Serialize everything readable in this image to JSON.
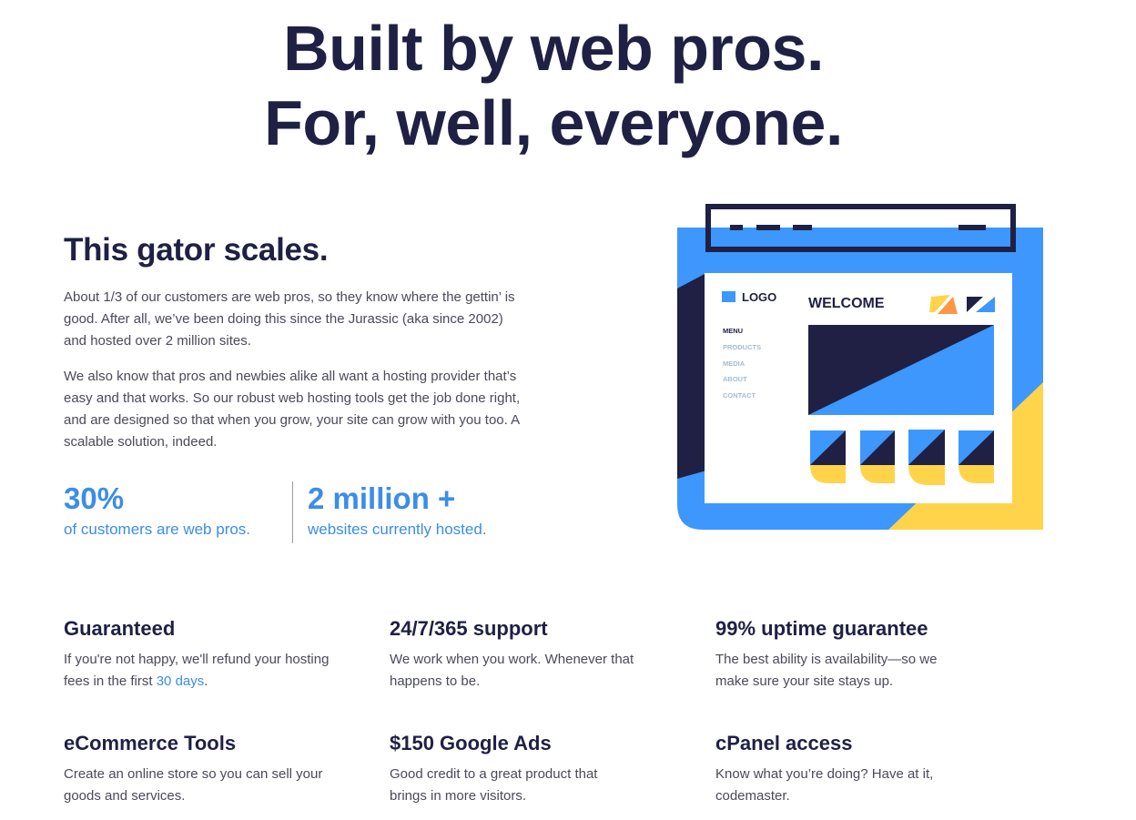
{
  "hero": {
    "line1": "Built by web pros.",
    "line2": "For, well, everyone."
  },
  "about": {
    "heading": "This gator scales.",
    "paragraphs": [
      "About 1/3 of our customers are web pros, so they know where the gettin’ is good. After all, we’ve been doing this since the Jurassic (aka since 2002) and hosted over 2 million sites.",
      "We also know that pros and newbies alike all want a hosting provider that’s easy and that works. So our robust web hosting tools get the job done right, and are designed so that when you grow, your site can grow with you too. A scalable solution, indeed."
    ],
    "stats": [
      {
        "value": "30%",
        "caption": "of customers are web pros."
      },
      {
        "value": "2 million +",
        "caption": "websites currently hosted."
      }
    ]
  },
  "illustration": {
    "icon": "website-mockup-illustration",
    "logo_label": "LOGO",
    "welcome_label": "WELCOME",
    "menu": [
      "MENU",
      "PRODUCTS",
      "MEDIA",
      "ABOUT",
      "CONTACT"
    ],
    "colors": {
      "navy": "#1f2044",
      "blue": "#3d97fc",
      "yellow": "#ffd44a",
      "orange": "#ff9645",
      "menu_muted": "#a9bccb"
    }
  },
  "features": [
    {
      "title": "Guaranteed",
      "desc_before": "If you're not happy, we'll refund your hosting fees in the first ",
      "link": "30 days",
      "desc_after": "."
    },
    {
      "title": "24/7/365 support",
      "desc": "We work when you work. Whenever that happens to be."
    },
    {
      "title": "99% uptime guarantee",
      "desc": "The best ability is availability—so we make sure your site stays up."
    },
    {
      "title": "eCommerce Tools",
      "desc": "Create an online store so you can sell your goods and services."
    },
    {
      "title": "$150 Google Ads",
      "desc": "Good credit to a great product that brings in more visitors."
    },
    {
      "title": "cPanel access",
      "desc": "Know what you’re doing? Have at it, codemaster."
    }
  ],
  "colors": {
    "heading": "#1f2044",
    "accent": "#3b8de8",
    "body_text": "#4a4a5a"
  }
}
